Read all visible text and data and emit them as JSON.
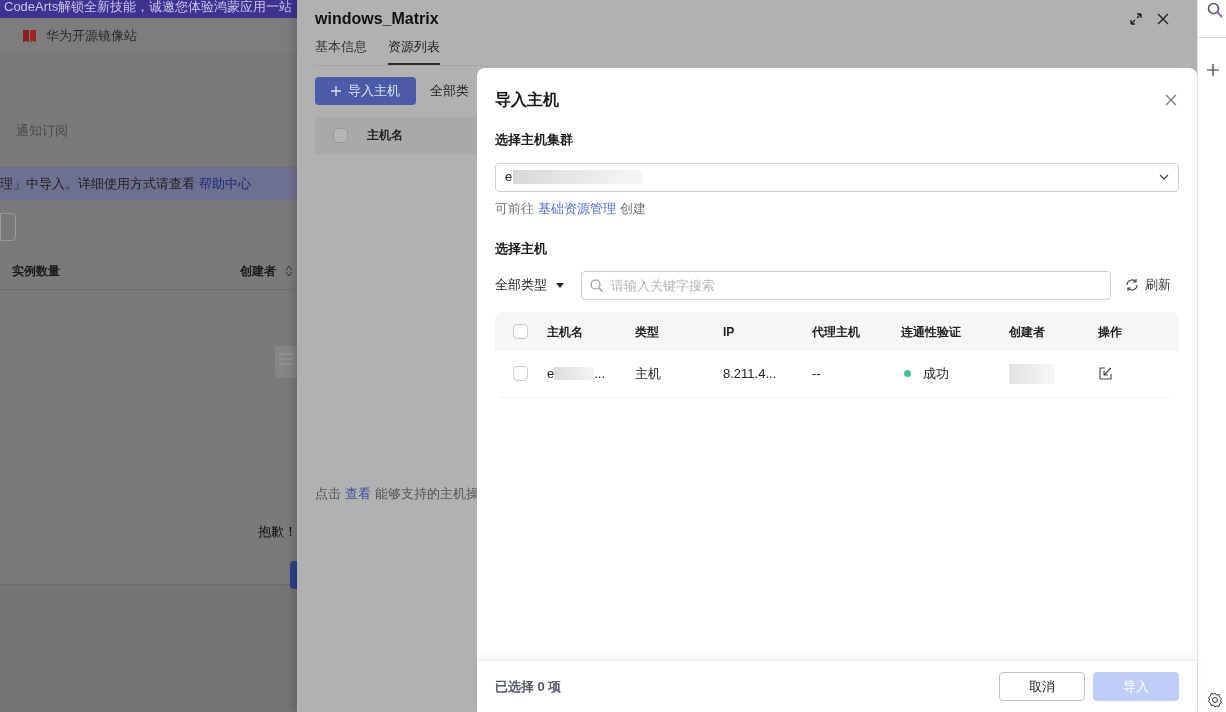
{
  "background_page": {
    "banner": "CodeArts解锁全新技能，诚邀您体验鸿蒙应用一站",
    "site_link": "华为开源镜像站",
    "nav_item": "通知订阅",
    "info_text": "理」中导入。详细使用方式请查看",
    "info_link": "帮助中心",
    "columns": [
      "实例数量",
      "创建者"
    ],
    "empty_text": "抱歉！"
  },
  "drawer": {
    "title": "windows_Matrix",
    "tabs": [
      {
        "label": "基本信息",
        "selected": false
      },
      {
        "label": "资源列表",
        "selected": true
      }
    ],
    "import_button": "导入主机",
    "type_filter": "全部类",
    "select_all_checked": false,
    "columns": [
      "主机名"
    ],
    "hint_prefix": "点击",
    "hint_link": "查看",
    "hint_suffix": "能够支持的主机操"
  },
  "dialog": {
    "title": "导入主机",
    "cluster_label": "选择主机集群",
    "cluster_value": "e",
    "cluster_hint_prefix": "可前往",
    "cluster_hint_link": "基础资源管理",
    "cluster_hint_suffix": "创建",
    "host_label": "选择主机",
    "type_filter": "全部类型",
    "search": {
      "placeholder": "请输入关键字搜索"
    },
    "refresh": "刷新",
    "select_all_checked": false,
    "columns": [
      "主机名",
      "类型",
      "IP",
      "代理主机",
      "连通性验证",
      "创建者",
      "操作"
    ],
    "rows": [
      {
        "checked": false,
        "host_name": "e",
        "host_name_end": "...",
        "type": "主机",
        "ip": "8.211.4...",
        "proxy": "--",
        "status": "成功",
        "color": "#3ec28a"
      }
    ],
    "selected_count": "已选择 0 项",
    "cancel": "取消",
    "import": {
      "label": "导入",
      "disabled": true
    }
  }
}
